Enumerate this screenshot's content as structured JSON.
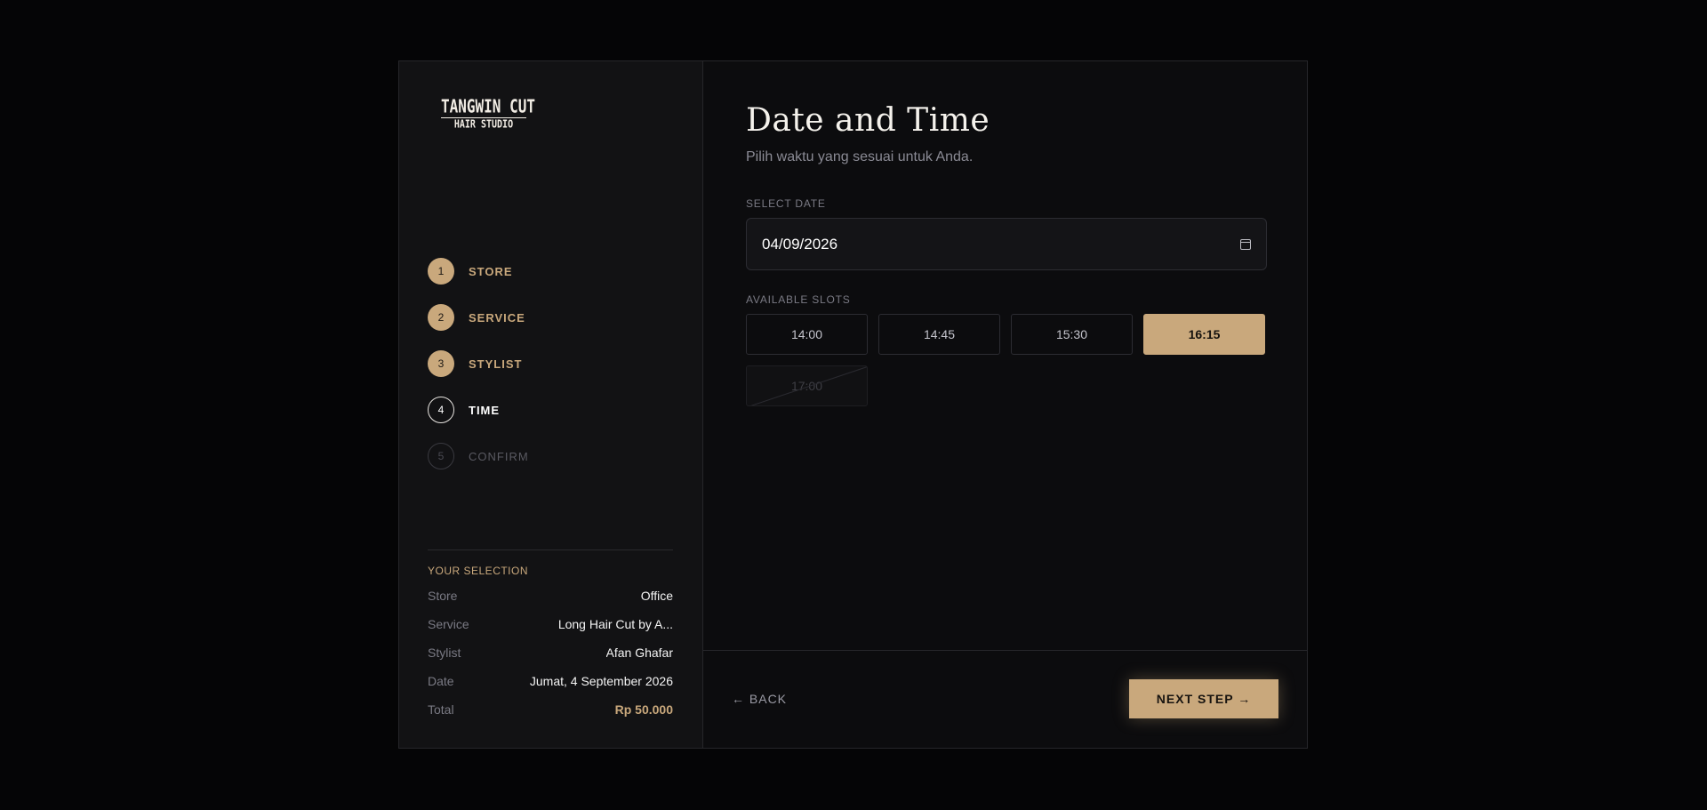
{
  "brand": {
    "logo_top": "TANGWIN CUT",
    "logo_sub": "HAIR STUDIO"
  },
  "steps": [
    {
      "number": "1",
      "label": "STORE",
      "state": "done"
    },
    {
      "number": "2",
      "label": "SERVICE",
      "state": "done"
    },
    {
      "number": "3",
      "label": "STYLIST",
      "state": "done"
    },
    {
      "number": "4",
      "label": "TIME",
      "state": "active"
    },
    {
      "number": "5",
      "label": "CONFIRM",
      "state": "pending"
    }
  ],
  "selection": {
    "title": "YOUR SELECTION",
    "rows": [
      {
        "key": "Store",
        "value": "Office"
      },
      {
        "key": "Service",
        "value": "Long Hair Cut by A..."
      },
      {
        "key": "Stylist",
        "value": "Afan Ghafar"
      },
      {
        "key": "Date",
        "value": "Jumat, 4 September 2026"
      },
      {
        "key": "Total",
        "value": "Rp 50.000"
      }
    ]
  },
  "main": {
    "title": "Date and Time",
    "subtitle": "Pilih waktu yang sesuai untuk Anda.",
    "date_label": "SELECT DATE",
    "date_value": "04/09/2026",
    "slots_label": "AVAILABLE SLOTS",
    "slots": [
      {
        "time": "14:00",
        "state": "available"
      },
      {
        "time": "14:45",
        "state": "available"
      },
      {
        "time": "15:30",
        "state": "available"
      },
      {
        "time": "16:15",
        "state": "selected"
      },
      {
        "time": "17:00",
        "state": "disabled"
      }
    ]
  },
  "footer": {
    "back_label": "← BACK",
    "next_label": "NEXT STEP →"
  },
  "colors": {
    "accent": "#c9a87c",
    "background": "#0c0c0e",
    "sidebar": "#121214"
  }
}
